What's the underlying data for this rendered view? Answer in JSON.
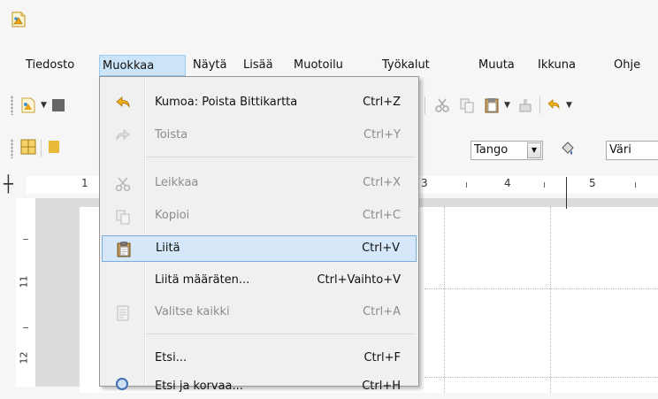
{
  "menubar": {
    "items": [
      {
        "label": "Tiedosto"
      },
      {
        "label": "Muokkaa"
      },
      {
        "label": "Näytä"
      },
      {
        "label": "Lisää"
      },
      {
        "label": "Muotoilu"
      },
      {
        "label": "Työkalut"
      },
      {
        "label": "Muuta"
      },
      {
        "label": "Ikkuna"
      },
      {
        "label": "Ohje"
      }
    ]
  },
  "edit_menu": {
    "items": [
      {
        "label": "Kumoa: Poista Bittikartta",
        "shortcut": "Ctrl+Z",
        "icon": "undo-icon",
        "enabled": true
      },
      {
        "label": "Toista",
        "shortcut": "Ctrl+Y",
        "icon": "redo-icon",
        "enabled": false
      },
      {
        "label": "Leikkaa",
        "shortcut": "Ctrl+X",
        "icon": "cut-icon",
        "enabled": false
      },
      {
        "label": "Kopioi",
        "shortcut": "Ctrl+C",
        "icon": "copy-icon",
        "enabled": false
      },
      {
        "label": "Liitä",
        "shortcut": "Ctrl+V",
        "icon": "paste-icon",
        "enabled": true,
        "highlighted": true
      },
      {
        "label": "Liitä määräten...",
        "shortcut": "Ctrl+Vaihto+V",
        "icon": "",
        "enabled": true
      },
      {
        "label": "Valitse kaikki",
        "shortcut": "Ctrl+A",
        "icon": "select-all-icon",
        "enabled": false
      },
      {
        "label": "Etsi...",
        "shortcut": "Ctrl+F",
        "icon": "",
        "enabled": true
      },
      {
        "label": "Etsi ja korvaa...",
        "shortcut": "Ctrl+H",
        "icon": "find-replace-icon",
        "enabled": true
      }
    ]
  },
  "toolbar2": {
    "gradient_value": "Tango",
    "area_color_value": "Väri"
  },
  "ruler": {
    "h_numbers": [
      "1",
      "3",
      "4",
      "5"
    ],
    "v_numbers": [
      "11",
      "12"
    ]
  },
  "colors": {
    "highlight": "#d5e7f8",
    "menu_active": "#cce4f7",
    "swatch": "#3465a4"
  }
}
